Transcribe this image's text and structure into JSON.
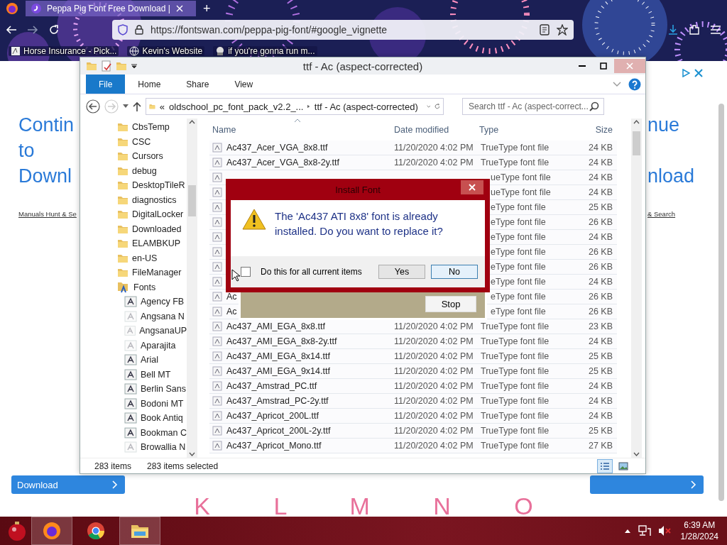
{
  "browser": {
    "tab": {
      "title": "Peppa Pig Font Free Download |",
      "selected": true
    },
    "new_tab": "+",
    "url": "https://fontswan.com/peppa-pig-font/#google_vignette",
    "bookmarks": [
      {
        "label": "Horse Insurance - Pick..."
      },
      {
        "label": "Kevin's Website"
      },
      {
        "label": "if you're gonna run m..."
      }
    ]
  },
  "web_page": {
    "heading_left": [
      "Contin",
      "to",
      "Downl"
    ],
    "heading_right": [
      "nue",
      "nload"
    ],
    "link_left": "Manuals Hunt & Se",
    "link_right": "& Search",
    "download_button": "Download",
    "letters": "K L M N O"
  },
  "explorer": {
    "title": "ttf - Ac (aspect-corrected)",
    "ribbon_tabs": [
      {
        "label": "File",
        "selected": true
      },
      {
        "label": "Home",
        "selected": false
      },
      {
        "label": "Share",
        "selected": false
      },
      {
        "label": "View",
        "selected": false
      }
    ],
    "overflow_marker": "«",
    "breadcrumb": [
      "oldschool_pc_font_pack_v2.2_...",
      "ttf - Ac (aspect-corrected)"
    ],
    "search": {
      "placeholder": "Search ttf - Ac (aspect-correct..."
    },
    "nav_items": [
      {
        "label": "CbsTemp",
        "kind": "folder"
      },
      {
        "label": "CSC",
        "kind": "folder"
      },
      {
        "label": "Cursors",
        "kind": "folder"
      },
      {
        "label": "debug",
        "kind": "folder"
      },
      {
        "label": "DesktopTileR",
        "kind": "folder"
      },
      {
        "label": "diagnostics",
        "kind": "folder"
      },
      {
        "label": "DigitalLocker",
        "kind": "folder"
      },
      {
        "label": "Downloaded",
        "kind": "folder"
      },
      {
        "label": "ELAMBKUP",
        "kind": "folder"
      },
      {
        "label": "en-US",
        "kind": "folder"
      },
      {
        "label": "FileManager",
        "kind": "folder"
      },
      {
        "label": "Fonts",
        "kind": "fonts",
        "children": [
          {
            "label": "Agency FB",
            "kind": "font",
            "dimmed": false
          },
          {
            "label": "Angsana N",
            "kind": "font",
            "dimmed": true
          },
          {
            "label": "AngsanaUP",
            "kind": "font",
            "dimmed": true
          },
          {
            "label": "Aparajita",
            "kind": "font",
            "dimmed": true
          },
          {
            "label": "Arial",
            "kind": "font",
            "dimmed": false
          },
          {
            "label": "Bell MT",
            "kind": "font",
            "dimmed": false
          },
          {
            "label": "Berlin Sans",
            "kind": "font",
            "dimmed": false
          },
          {
            "label": "Bodoni MT",
            "kind": "font",
            "dimmed": false
          },
          {
            "label": "Book Antiq",
            "kind": "font",
            "dimmed": false
          },
          {
            "label": "Bookman C",
            "kind": "font",
            "dimmed": false
          },
          {
            "label": "Browallia N",
            "kind": "font",
            "dimmed": true
          }
        ]
      }
    ],
    "columns": [
      "Name",
      "Date modified",
      "Type",
      "Size"
    ],
    "rows": [
      {
        "name": "Ac437_Acer_VGA_8x8.ttf",
        "date": "11/20/2020 4:02 PM",
        "type": "TrueType font file",
        "size": "24 KB"
      },
      {
        "name": "Ac437_Acer_VGA_8x8-2y.ttf",
        "date": "11/20/2020 4:02 PM",
        "type": "TrueType font file",
        "size": "24 KB"
      },
      {
        "type": "ueType font file",
        "size": "24 KB"
      },
      {
        "type": "ueType font file",
        "size": "24 KB"
      },
      {
        "type": "eType font file",
        "size": "25 KB"
      },
      {
        "type": "eType font file",
        "size": "26 KB"
      },
      {
        "type": "eType font file",
        "size": "24 KB"
      },
      {
        "type": "eType font file",
        "size": "26 KB"
      },
      {
        "type": "eType font file",
        "size": "26 KB"
      },
      {
        "type": "eType font file",
        "size": "24 KB"
      },
      {
        "name": "Ac",
        "type": "eType font file",
        "size": "26 KB"
      },
      {
        "name": "Ac",
        "type": "eType font file",
        "size": "26 KB"
      },
      {
        "name": "Ac437_AMI_EGA_8x8.ttf",
        "date": "11/20/2020 4:02 PM",
        "type": "TrueType font file",
        "size": "23 KB"
      },
      {
        "name": "Ac437_AMI_EGA_8x8-2y.ttf",
        "date": "11/20/2020 4:02 PM",
        "type": "TrueType font file",
        "size": "24 KB"
      },
      {
        "name": "Ac437_AMI_EGA_8x14.ttf",
        "date": "11/20/2020 4:02 PM",
        "type": "TrueType font file",
        "size": "25 KB"
      },
      {
        "name": "Ac437_AMI_EGA_9x14.ttf",
        "date": "11/20/2020 4:02 PM",
        "type": "TrueType font file",
        "size": "25 KB"
      },
      {
        "name": "Ac437_Amstrad_PC.ttf",
        "date": "11/20/2020 4:02 PM",
        "type": "TrueType font file",
        "size": "24 KB"
      },
      {
        "name": "Ac437_Amstrad_PC-2y.ttf",
        "date": "11/20/2020 4:02 PM",
        "type": "TrueType font file",
        "size": "24 KB"
      },
      {
        "name": "Ac437_Apricot_200L.ttf",
        "date": "11/20/2020 4:02 PM",
        "type": "TrueType font file",
        "size": "24 KB"
      },
      {
        "name": "Ac437_Apricot_200L-2y.ttf",
        "date": "11/20/2020 4:02 PM",
        "type": "TrueType font file",
        "size": "25 KB"
      },
      {
        "name": "Ac437_Apricot_Mono.ttf",
        "date": "11/20/2020 4:02 PM",
        "type": "TrueType font file",
        "size": "27 KB"
      }
    ],
    "status": {
      "count": "283 items",
      "selection": "283 items selected"
    },
    "views": [
      {
        "kind": "details",
        "selected": true
      },
      {
        "kind": "tiles",
        "selected": false
      }
    ]
  },
  "dialog": {
    "title": "Install Font",
    "message": "The 'Ac437 ATI 8x8' font is already installed. Do you want to replace it?",
    "checkbox": {
      "label": "Do this for all current items",
      "checked": false
    },
    "buttons": [
      {
        "label": "Yes",
        "default": false
      },
      {
        "label": "No",
        "default": true
      }
    ]
  },
  "progress_dialog": {
    "button": "Stop"
  },
  "taskbar": {
    "apps": [
      {
        "kind": "firefox",
        "open": true
      },
      {
        "kind": "chrome",
        "open": false
      },
      {
        "kind": "explorer",
        "open": true
      }
    ],
    "time": "6:39 AM",
    "date": "1/28/2024"
  }
}
